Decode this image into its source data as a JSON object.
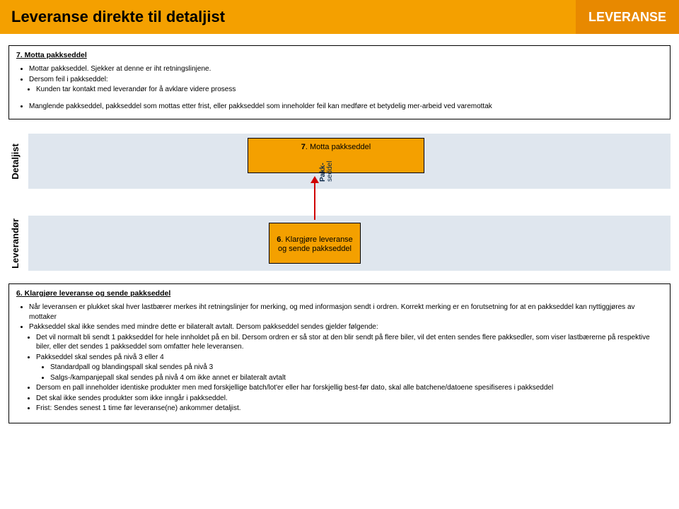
{
  "header": {
    "title": "Leveranse direkte til detaljist",
    "tag": "LEVERANSE"
  },
  "topBox": {
    "heading": "7. Motta pakkseddel",
    "b1": "Mottar pakkseddel. Sjekker at denne er iht retningslinjene.",
    "b2": "Dersom feil i pakkseddel:",
    "b2a": "Kunden tar kontakt med leverandør for å avklare videre prosess",
    "b3": "Manglende pakkseddel, pakkseddel som mottas etter frist,  eller pakkseddel som inneholder feil kan medføre et betydelig mer-arbeid ved varemottak"
  },
  "lanes": {
    "topLabel": "Detaljist",
    "botLabel": "Leverandør"
  },
  "nodes": {
    "step7_num": "7",
    "step7_text": ". Motta pakkseddel",
    "step6_num": "6",
    "step6_text": ". Klargjøre leveranse og sende pakkseddel"
  },
  "arrow": {
    "l1": "Pakk-",
    "l2": "seddel"
  },
  "bottomBox": {
    "heading": "6. Klargjøre  leveranse  og sende  pakkseddel",
    "b1": "Når leveransen er plukket skal hver lastbærer merkes iht retningslinjer for merking, og med informasjon sendt i ordren. Korrekt merking er en forutsetning for at en pakkseddel kan nyttiggjøres av mottaker",
    "b2": "Pakkseddel skal ikke sendes med mindre dette er bilateralt avtalt. Dersom pakkseddel sendes gjelder følgende:",
    "b2a": "Det vil normalt bli sendt 1 pakkseddel for hele innholdet på en bil. Dersom ordren er så stor at den blir sendt på flere biler, vil det enten sendes flere pakksedler, som viser lastbærerne på respektive biler, eller det sendes 1 pakkseddel som omfatter hele leveransen.",
    "b2b": "Pakkseddel skal sendes på nivå 3 eller 4",
    "b2b1": "Standardpall og blandingspall skal sendes på nivå 3",
    "b2b2": "Salgs-/kampanjepall skal sendes på nivå 4 om ikke annet er bilateralt avtalt",
    "b2c": "Dersom en pall inneholder identiske produkter men med forskjellige batch/lot'er eller har forskjellig best-før dato, skal alle batchene/datoene spesifiseres i pakkseddel",
    "b2d": "Det skal ikke sendes produkter som ikke inngår i pakkseddel.",
    "b2e": "Frist: Sendes senest 1 time før leveranse(ne) ankommer detaljist."
  }
}
